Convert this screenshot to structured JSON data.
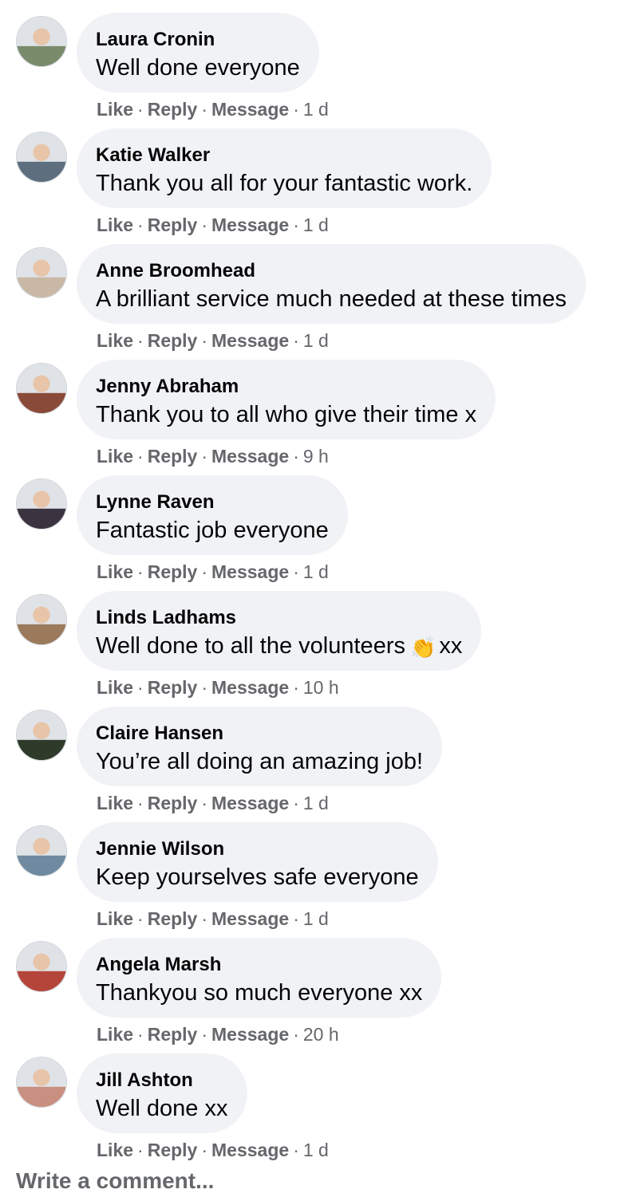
{
  "comments": [
    {
      "author": "Laura Cronin",
      "text": "Well done everyone",
      "time": "1 d",
      "avatar": "avatar-photo"
    },
    {
      "author": "Katie Walker",
      "text": "Thank you all for your fantastic work.",
      "time": "1 d",
      "avatar": "avatar-photo"
    },
    {
      "author": "Anne Broomhead",
      "text": "A brilliant service much needed at these times",
      "time": "1 d",
      "avatar": "avatar-photo"
    },
    {
      "author": "Jenny Abraham",
      "text": "Thank you to all who give their time x",
      "time": "9 h",
      "avatar": "avatar-photo"
    },
    {
      "author": "Lynne Raven",
      "text": "Fantastic job everyone",
      "time": "1 d",
      "avatar": "avatar-photo"
    },
    {
      "author": "Linds Ladhams",
      "text": "Well done to all the volunteers",
      "text_suffix": "xx",
      "emoji": "clapping-hands-icon",
      "emoji_glyph": "👏",
      "time": "10 h",
      "avatar": "avatar-photo"
    },
    {
      "author": "Claire Hansen",
      "text": "You’re all doing an amazing job!",
      "time": "1 d",
      "avatar": "avatar-photo"
    },
    {
      "author": "Jennie Wilson",
      "text": "Keep yourselves safe everyone",
      "time": "1 d",
      "avatar": "avatar-photo"
    },
    {
      "author": "Angela Marsh",
      "text": "Thankyou so much everyone xx",
      "time": "20 h",
      "avatar": "avatar-photo"
    },
    {
      "author": "Jill Ashton",
      "text": "Well done xx",
      "time": "1 d",
      "avatar": "avatar-photo"
    }
  ],
  "actions": {
    "like": "Like",
    "reply": "Reply",
    "message": "Message",
    "separator": "·"
  },
  "composer": {
    "placeholder": "Write a comment..."
  },
  "colors": {
    "bubble": "#f0f2f5",
    "text": "#050505",
    "secondary": "#65676b",
    "avatar_palette": [
      "#7a8b6c",
      "#5d6e7e",
      "#c9b8a6",
      "#8a4a3a",
      "#3b3340",
      "#9a7a5a",
      "#2f3b2a",
      "#6f8aa0",
      "#b5453a",
      "#c98f80"
    ]
  }
}
